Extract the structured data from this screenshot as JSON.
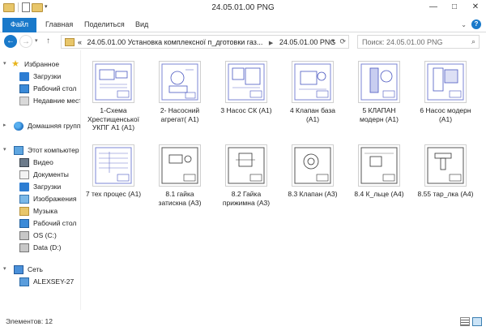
{
  "window": {
    "title": "24.05.01.00 PNG",
    "buttons": {
      "minimize": "—",
      "maximize": "□",
      "close": "✕"
    }
  },
  "ribbon": {
    "file": "Файл",
    "tabs": [
      "Главная",
      "Поделиться",
      "Вид"
    ]
  },
  "address": {
    "prefix": "«",
    "crumb1": "24.05.01.00 Установка комплексної п_дготовки газ...",
    "crumb2": "24.05.01.00 PNG"
  },
  "search": {
    "placeholder": "Поиск: 24.05.01.00 PNG"
  },
  "sidebar": {
    "favorites": "Избранное",
    "downloads": "Загрузки",
    "desktop": "Рабочий стол",
    "recent": "Недавние мест",
    "homegroup": "Домашняя групп",
    "computer": "Этот компьютер",
    "video": "Видео",
    "documents": "Документы",
    "downloads2": "Загрузки",
    "images": "Изображения",
    "music": "Музыка",
    "desktop2": "Рабочий стол",
    "osc": "OS (C:)",
    "datad": "Data (D:)",
    "network": "Сеть",
    "host": "ALEXSEY-27"
  },
  "files": [
    {
      "line1": "1-Схема",
      "line2": "Хрестищенської",
      "line3": "УКПГ А1 (А1)"
    },
    {
      "line1": "2- Насосний",
      "line2": "агрегат( А1)",
      "line3": ""
    },
    {
      "line1": "3 Насос СК (А1)",
      "line2": "",
      "line3": ""
    },
    {
      "line1": "4 Клапан база",
      "line2": "(А1)",
      "line3": ""
    },
    {
      "line1": "5 КЛАПАН",
      "line2": "модерн (А1)",
      "line3": ""
    },
    {
      "line1": "6 Насос модерн",
      "line2": "(А1)",
      "line3": ""
    },
    {
      "line1": "7 тех процес (А1)",
      "line2": "",
      "line3": ""
    },
    {
      "line1": "8.1 гайка",
      "line2": "затискна (А3)",
      "line3": ""
    },
    {
      "line1": "8.2 Гайка",
      "line2": "прижимна (А3)",
      "line3": ""
    },
    {
      "line1": "8.3 Клапан (А3)",
      "line2": "",
      "line3": ""
    },
    {
      "line1": "8.4 К_льце (А4)",
      "line2": "",
      "line3": ""
    },
    {
      "line1": "8.55 тар_лка (А4)",
      "line2": "",
      "line3": ""
    }
  ],
  "status": {
    "count": "Элементов: 12"
  }
}
